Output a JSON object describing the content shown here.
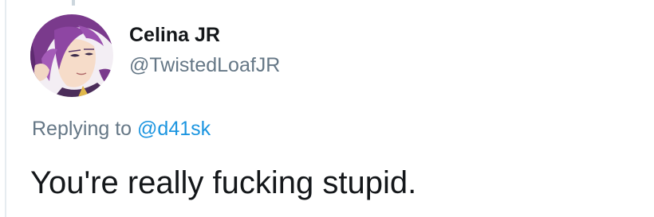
{
  "tweet": {
    "author": {
      "display_name": "Celina JR",
      "handle": "@TwistedLoafJR",
      "avatar_icon": "anime-character-avatar"
    },
    "replying_to": {
      "prefix": "Replying to",
      "mention": "@d41sk"
    },
    "text": "You're really fucking stupid."
  },
  "colors": {
    "name": "#14171a",
    "secondary": "#657786",
    "link": "#1b95e0",
    "thread_line": "#e6ecf0"
  }
}
